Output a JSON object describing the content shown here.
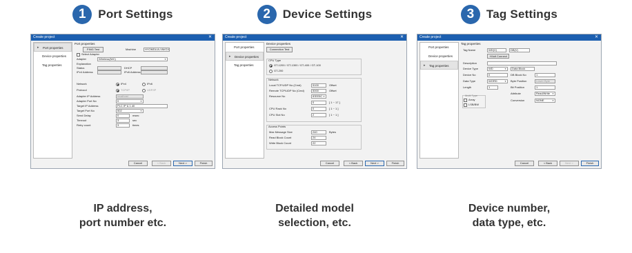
{
  "steps": [
    {
      "num": "1",
      "title": "Port Settings",
      "caption_line1": "IP address,",
      "caption_line2": "port number etc."
    },
    {
      "num": "2",
      "title": "Device Settings",
      "caption_line1": "Detailed model",
      "caption_line2": "selection, etc."
    },
    {
      "num": "3",
      "title": "Tag Settings",
      "caption_line1": "Device number,",
      "caption_line2": "data type, etc."
    }
  ],
  "window": {
    "title": "Create project",
    "nav": [
      "Port properties",
      "Device properties",
      "Tag properties"
    ],
    "buttons": {
      "cancel": "Cancel",
      "back": "< Back",
      "next": "Next >",
      "finish": "Finish"
    }
  },
  "port": {
    "heading": "Port properties",
    "ping_btn": "PING Test",
    "machine_label": "Machine",
    "machine_value": "HYOMDLIA-VM/GX",
    "select_adapter": "Select Adapter",
    "adapter_label": "Adapter",
    "adapter_value": "Wireless(NIC)",
    "explanation_label": "Explanation",
    "status_label": "Status",
    "dhcp_label": "DHCP",
    "ipv4_label": "IPv4 Address",
    "ipv6_label": "IPv6 Address",
    "network_label": "Network",
    "ipv4_radio": "IPv4",
    "ipv6_radio": "IPv6",
    "protocol_label": "Protocol",
    "tcp_radio": "TCP/IP",
    "udp_radio": "UDP/IP",
    "adapter_ip_label": "Adapter IP Address",
    "adapter_ip_value": "localhost",
    "adapter_port_label": "Adapter Port No",
    "adapter_port_value": "0",
    "target_ip_label": "Target IP Address",
    "target_ip_value": "PLC IP & 1.40",
    "target_port_label": "Target Port No",
    "target_port_value": "502",
    "send_delay_label": "Send Delay",
    "send_delay_value": "0",
    "send_delay_unit": "msec",
    "timeout_label": "Timeout",
    "timeout_value": "3",
    "timeout_unit": "sec",
    "retry_label": "Retry count",
    "retry_value": "3",
    "retry_unit": "times"
  },
  "device": {
    "heading": "Device properties",
    "conn_btn": "Connection Test",
    "cpu_group": "CPU Type",
    "cpu_opt1": "GT-1200 / GT-1300 / GT-400 / GT-100",
    "cpu_opt2": "GT-200",
    "network_group": "Network",
    "local_port_label": "Local TCP/UDP No (Cmd)",
    "local_port_value": "5100",
    "local_port_unit": "Offset",
    "remote_port_label": "Remote TCP/UDP No (Cmd)",
    "remote_port_value": "5000",
    "remote_port_unit": "Offset",
    "resource_label": "Resource No",
    "resource_value": "IEEE5C",
    "range_value": "0",
    "range_text": "[ 1 ~ 17 ]",
    "cpu_rack_label": "CPU Rack No",
    "cpu_rack_value": "0",
    "cpu_rack_range": "[ 1 ~ 1 ]",
    "cpu_slot_label": "CPU Slot No",
    "cpu_slot_value": "2",
    "cpu_slot_range": "[ 1 ~ 1 ]",
    "access_group": "Access Points",
    "max_msg_label": "Max Message Size",
    "max_msg_value": "240",
    "max_msg_unit": "Bytes",
    "read_block_label": "Read Block Count",
    "read_block_value": "24",
    "write_block_label": "Write Block Count",
    "write_block_value": "22"
  },
  "tag": {
    "heading": "Tag properties",
    "tagname_label": "Tag Name",
    "tagname_v1": "WD(V)",
    "tagname_v2": "DB(V)",
    "multi_btn": "+Mult Connect",
    "description_label": "Description",
    "device_type_label": "Device Type",
    "device_type_value": "WD",
    "device_type_sel": "Data Block",
    "device_no_label": "Device No",
    "device_no_value": "0",
    "db_block_label": "DB Block No",
    "db_block_value": "1",
    "data_type_label": "Data Type",
    "data_type_value": "WORD",
    "data_type_sel": "Byte Position",
    "byte_pos_value": "Lower Byte",
    "length_label": "Length",
    "length_value": "1",
    "bit_position_label": "Bit Position",
    "bit_position_value": "1",
    "attribute_label": "Attribute",
    "attribute_value": "Read/Write",
    "array_label": "Array",
    "multi_label": "Multi Type",
    "lsb_label": "LSB/BW",
    "conversion_label": "Conversion",
    "conversion_value": "NONE"
  }
}
